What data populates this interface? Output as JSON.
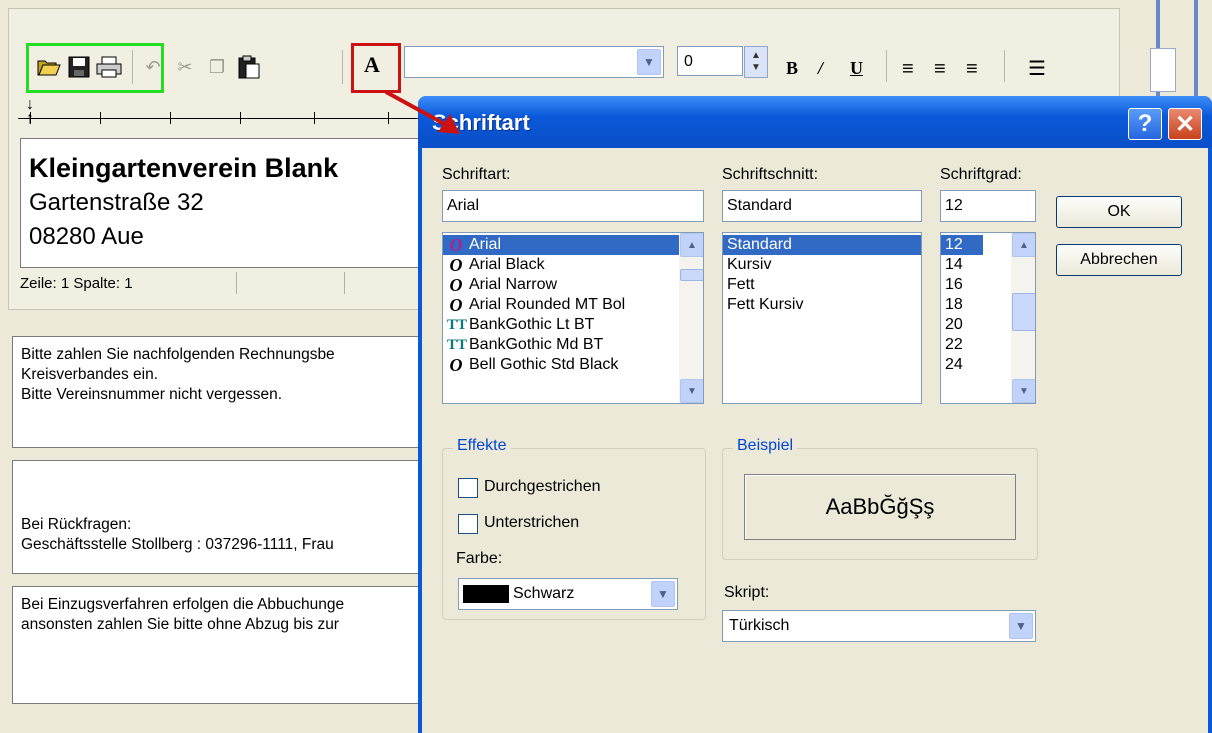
{
  "app": {
    "address_lines": [
      "Kleingartenverein Blank",
      "Gartenstraße 32",
      "08280 Aue"
    ],
    "status": "Zeile:  1   Spalte:  1",
    "font_size_value": "0",
    "toolbar_icons": [
      "open-icon",
      "save-icon",
      "print-icon",
      "undo-icon",
      "cut-icon",
      "copy-icon",
      "paste-icon",
      "font-icon",
      "bold-icon",
      "italic-icon",
      "underline-icon",
      "align-left-icon",
      "align-center-icon",
      "align-right-icon",
      "list-icon"
    ],
    "format_glyphs": {
      "font": "A",
      "bold": "B",
      "italic": "/",
      "underline": "U"
    },
    "text_box_1": [
      "Bitte zahlen Sie nachfolgenden Rechnungsbe",
      "Kreisverbandes ein.",
      "Bitte Vereinsnummer nicht vergessen."
    ],
    "text_box_2": [
      "Bei Rückfragen:",
      "Geschäftsstelle Stollberg : 037296-1111, Frau"
    ],
    "text_box_3": [
      "Bei Einzugsverfahren erfolgen die Abbuchunge",
      "ansonsten zahlen Sie bitte ohne Abzug bis zur"
    ]
  },
  "dialog": {
    "title": "Schriftart",
    "help": "?",
    "close": "✕",
    "font_label": "Schriftart:",
    "font_value": "Arial",
    "fonts": [
      {
        "name": "Arial",
        "icon": "O",
        "type": "opentype"
      },
      {
        "name": "Arial Black",
        "icon": "O",
        "type": "opentype"
      },
      {
        "name": "Arial Narrow",
        "icon": "O",
        "type": "opentype"
      },
      {
        "name": "Arial Rounded MT Bol",
        "icon": "O",
        "type": "opentype"
      },
      {
        "name": "BankGothic Lt BT",
        "icon": "TT",
        "type": "truetype"
      },
      {
        "name": "BankGothic Md BT",
        "icon": "TT",
        "type": "truetype"
      },
      {
        "name": "Bell Gothic Std Black",
        "icon": "O",
        "type": "opentype"
      }
    ],
    "style_label": "Schriftschnitt:",
    "style_value": "Standard",
    "styles": [
      "Standard",
      "Kursiv",
      "Fett",
      "Fett Kursiv"
    ],
    "size_label": "Schriftgrad:",
    "size_value": "12",
    "sizes": [
      "12",
      "14",
      "16",
      "18",
      "20",
      "22",
      "24"
    ],
    "ok": "OK",
    "cancel": "Abbrechen",
    "effects_title": "Effekte",
    "strike": "Durchgestrichen",
    "underline": "Unterstrichen",
    "color_label": "Farbe:",
    "color_value": "Schwarz",
    "sample_title": "Beispiel",
    "sample_text": "AaBbĞğŞş",
    "script_label": "Skript:",
    "script_value": "Türkisch"
  },
  "colors": {
    "highlight_green": "#22dd22",
    "highlight_red": "#cc1111",
    "selection": "#316ac5",
    "titlebar": "#0a58d8"
  }
}
